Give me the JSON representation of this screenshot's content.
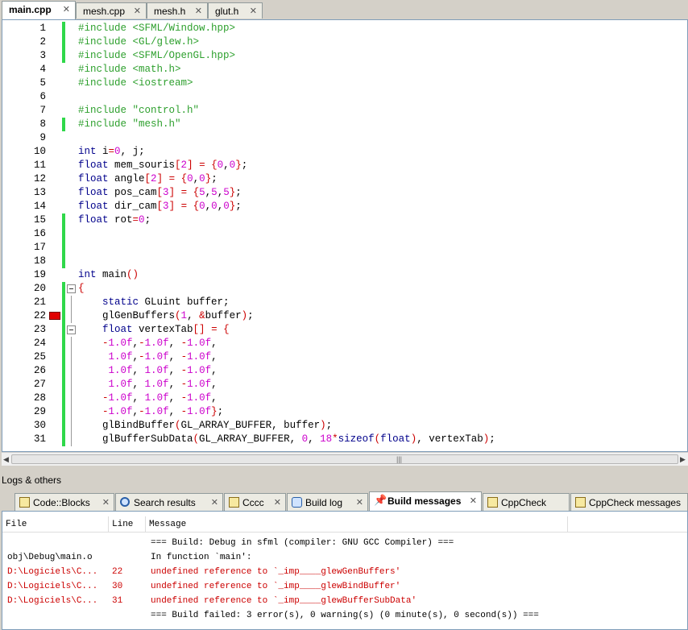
{
  "file_tabs": [
    {
      "label": "main.cpp",
      "active": true
    },
    {
      "label": "mesh.cpp",
      "active": false
    },
    {
      "label": "mesh.h",
      "active": false
    },
    {
      "label": "glut.h",
      "active": false
    }
  ],
  "code_lines": [
    {
      "n": "1",
      "html": "<span class='pp'>#include &lt;SFML/Window.hpp&gt;</span>"
    },
    {
      "n": "2",
      "html": "<span class='pp'>#include &lt;GL/glew.h&gt;</span>"
    },
    {
      "n": "3",
      "html": "<span class='pp'>#include &lt;SFML/OpenGL.hpp&gt;</span>"
    },
    {
      "n": "4",
      "html": "<span class='pp'>#include &lt;math.h&gt;</span>"
    },
    {
      "n": "5",
      "html": "<span class='pp'>#include &lt;iostream&gt;</span>"
    },
    {
      "n": "6",
      "html": ""
    },
    {
      "n": "7",
      "html": "<span class='pp'>#include \"control.h\"</span>"
    },
    {
      "n": "8",
      "html": "<span class='pp'>#include \"mesh.h\"</span>"
    },
    {
      "n": "9",
      "html": ""
    },
    {
      "n": "10",
      "html": "<span class='kw'>int</span> i<span class='op'>=</span><span class='num'>0</span>, j;"
    },
    {
      "n": "11",
      "html": "<span class='kw'>float</span> mem_souris<span class='op'>[</span><span class='num'>2</span><span class='op'>]</span> <span class='op'>=</span> <span class='op'>{</span><span class='num'>0</span>,<span class='num'>0</span><span class='op'>}</span>;"
    },
    {
      "n": "12",
      "html": "<span class='kw'>float</span> angle<span class='op'>[</span><span class='num'>2</span><span class='op'>]</span> <span class='op'>=</span> <span class='op'>{</span><span class='num'>0</span>,<span class='num'>0</span><span class='op'>}</span>;"
    },
    {
      "n": "13",
      "html": "<span class='kw'>float</span> pos_cam<span class='op'>[</span><span class='num'>3</span><span class='op'>]</span> <span class='op'>=</span> <span class='op'>{</span><span class='num'>5</span>,<span class='num'>5</span>,<span class='num'>5</span><span class='op'>}</span>;"
    },
    {
      "n": "14",
      "html": "<span class='kw'>float</span> dir_cam<span class='op'>[</span><span class='num'>3</span><span class='op'>]</span> <span class='op'>=</span> <span class='op'>{</span><span class='num'>0</span>,<span class='num'>0</span>,<span class='num'>0</span><span class='op'>}</span>;"
    },
    {
      "n": "15",
      "html": "<span class='kw'>float</span> rot<span class='op'>=</span><span class='num'>0</span>;"
    },
    {
      "n": "16",
      "html": ""
    },
    {
      "n": "17",
      "html": ""
    },
    {
      "n": "18",
      "html": ""
    },
    {
      "n": "19",
      "html": "<span class='kw'>int</span> main<span class='op'>()</span>"
    },
    {
      "n": "20",
      "html": "<span class='op'>{</span>"
    },
    {
      "n": "21",
      "html": "    <span class='kw'>static</span> GLuint buffer;"
    },
    {
      "n": "22",
      "html": "    glGenBuffers<span class='op'>(</span><span class='num'>1</span>, <span class='op'>&amp;</span>buffer<span class='op'>)</span>;"
    },
    {
      "n": "23",
      "html": "    <span class='kw'>float</span> vertexTab<span class='op'>[]</span> <span class='op'>=</span> <span class='op'>{</span>"
    },
    {
      "n": "24",
      "html": "    <span class='op'>-</span><span class='num'>1.0f</span>,<span class='op'>-</span><span class='num'>1.0f</span>, <span class='op'>-</span><span class='num'>1.0f</span>,"
    },
    {
      "n": "25",
      "html": "     <span class='num'>1.0f</span>,<span class='op'>-</span><span class='num'>1.0f</span>, <span class='op'>-</span><span class='num'>1.0f</span>,"
    },
    {
      "n": "26",
      "html": "     <span class='num'>1.0f</span>, <span class='num'>1.0f</span>, <span class='op'>-</span><span class='num'>1.0f</span>,"
    },
    {
      "n": "27",
      "html": "     <span class='num'>1.0f</span>, <span class='num'>1.0f</span>, <span class='op'>-</span><span class='num'>1.0f</span>,"
    },
    {
      "n": "28",
      "html": "    <span class='op'>-</span><span class='num'>1.0f</span>, <span class='num'>1.0f</span>, <span class='op'>-</span><span class='num'>1.0f</span>,"
    },
    {
      "n": "29",
      "html": "    <span class='op'>-</span><span class='num'>1.0f</span>,<span class='op'>-</span><span class='num'>1.0f</span>, <span class='op'>-</span><span class='num'>1.0f</span><span class='op'>}</span>;"
    },
    {
      "n": "30",
      "html": "    glBindBuffer<span class='op'>(</span>GL_ARRAY_BUFFER, buffer<span class='op'>)</span>;"
    },
    {
      "n": "31",
      "html": "    glBufferSubData<span class='op'>(</span>GL_ARRAY_BUFFER, <span class='num'>0</span>, <span class='num'>18</span><span class='op'>*</span><span class='kw'>sizeof</span><span class='op'>(</span><span class='kw'>float</span><span class='op'>)</span>, vertexTab<span class='op'>)</span>;"
    }
  ],
  "logs": {
    "title": "Logs & others",
    "tabs": [
      {
        "label": "Code::Blocks",
        "icon": "document-icon"
      },
      {
        "label": "Search results",
        "icon": "search-icon"
      },
      {
        "label": "Cccc",
        "icon": "document-icon"
      },
      {
        "label": "Build log",
        "icon": "build-icon"
      },
      {
        "label": "Build messages",
        "icon": "pin-icon",
        "active": true
      },
      {
        "label": "CppCheck",
        "icon": "document-icon"
      },
      {
        "label": "CppCheck messages",
        "icon": "document-icon"
      }
    ],
    "columns": [
      "File",
      "Line",
      "Message"
    ],
    "rows": [
      {
        "file": "",
        "line": "",
        "message": "=== Build: Debug in sfml (compiler: GNU GCC Compiler) ===",
        "error": false
      },
      {
        "file": "obj\\Debug\\main.o",
        "line": "",
        "message": "In function `main':",
        "error": false
      },
      {
        "file": "D:\\Logiciels\\C...",
        "line": "22",
        "message": "undefined reference to `_imp____glewGenBuffers'",
        "error": true
      },
      {
        "file": "D:\\Logiciels\\C...",
        "line": "30",
        "message": "undefined reference to `_imp____glewBindBuffer'",
        "error": true
      },
      {
        "file": "D:\\Logiciels\\C...",
        "line": "31",
        "message": "undefined reference to `_imp____glewBufferSubData'",
        "error": true
      },
      {
        "file": "",
        "line": "",
        "message": "=== Build failed: 3 error(s), 0 warning(s) (0 minute(s), 0 second(s)) ===",
        "error": false
      }
    ]
  }
}
